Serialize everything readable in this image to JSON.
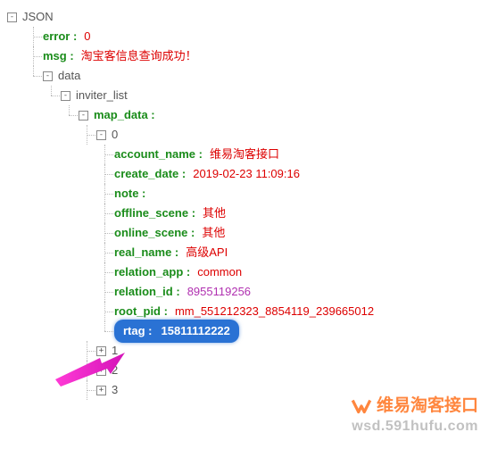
{
  "root": {
    "label": "JSON"
  },
  "error": {
    "key": "error :",
    "value": "0"
  },
  "msg": {
    "key": "msg :",
    "value": "淘宝客信息查询成功！"
  },
  "data": {
    "label": "data"
  },
  "inviter_list": {
    "label": "inviter_list"
  },
  "map_data": {
    "key": "map_data :"
  },
  "idx0": {
    "label": "0"
  },
  "fields": {
    "account_name": {
      "key": "account_name :",
      "value": "维易淘客接口"
    },
    "create_date": {
      "key": "create_date :",
      "value": "2019-02-23 11:09:16"
    },
    "note": {
      "key": "note :"
    },
    "offline_scene": {
      "key": "offline_scene :",
      "value": "其他"
    },
    "online_scene": {
      "key": "online_scene :",
      "value": "其他"
    },
    "real_name": {
      "key": "real_name :",
      "value": "高级API"
    },
    "relation_app": {
      "key": "relation_app :",
      "value": "common"
    },
    "relation_id": {
      "key": "relation_id :",
      "value": "8955119256"
    },
    "root_pid": {
      "key": "root_pid :",
      "value": "mm_551212323_8854119_239665012"
    },
    "rtag": {
      "key": "rtag :",
      "value": "15811112222"
    }
  },
  "idx1": {
    "label": "1"
  },
  "idx2": {
    "label": "2"
  },
  "idx3": {
    "label": "3"
  },
  "toggle": {
    "minus": "-",
    "plus": "+"
  },
  "watermark": {
    "title": "维易淘客接口",
    "url": "wsd.591hufu.com"
  }
}
